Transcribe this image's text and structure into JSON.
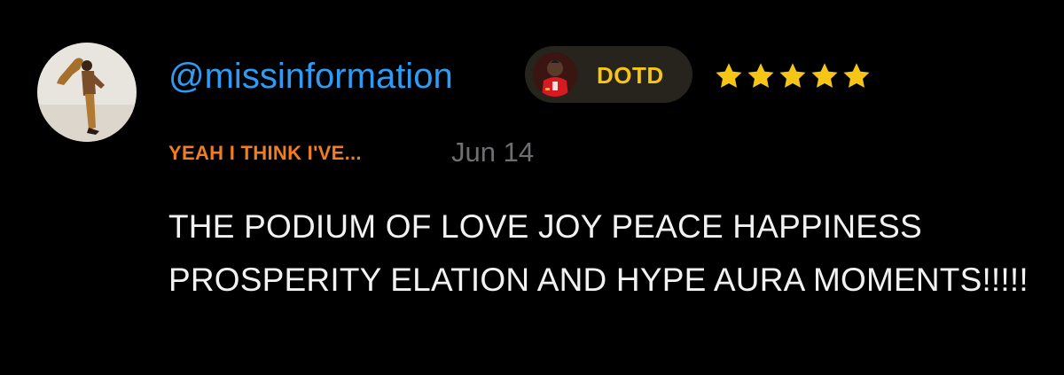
{
  "comment": {
    "username": "@missinformation",
    "badge": {
      "label": "DOTD",
      "icon": "driver-avatar-icon"
    },
    "rating": {
      "stars": 5,
      "max": 5,
      "icon": "star-icon"
    },
    "caption": "YEAH I THINK I'VE...",
    "date": "Jun 14",
    "text": "THE PODIUM OF LOVE JOY PEACE HAPPINESS PROSPERITY ELATION AND HYPE AURA MOMENTS!!!!!"
  },
  "colors": {
    "background": "#000000",
    "username": "#2f9bf3",
    "badge_background": "#26241d",
    "badge_text": "#f5c518",
    "star": "#f5c518",
    "caption": "#f07d21",
    "date": "#6e6e73",
    "text": "#f2f2f2"
  }
}
